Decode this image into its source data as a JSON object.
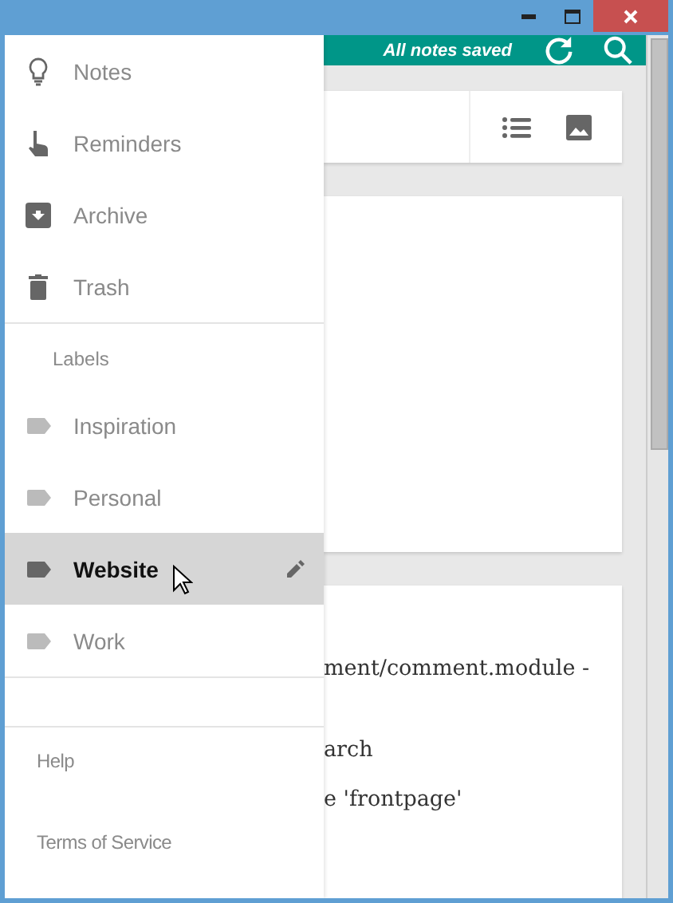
{
  "header": {
    "status": "All notes saved"
  },
  "drawer": {
    "nav": [
      {
        "label": "Notes",
        "kind": "bulb"
      },
      {
        "label": "Reminders",
        "kind": "hand"
      },
      {
        "label": "Archive",
        "kind": "archive"
      },
      {
        "label": "Trash",
        "kind": "trash"
      }
    ],
    "labels_heading": "Labels",
    "labels": [
      {
        "label": "Inspiration",
        "selected": false
      },
      {
        "label": "Personal",
        "selected": false
      },
      {
        "label": "Website",
        "selected": true
      },
      {
        "label": "Work",
        "selected": false
      }
    ],
    "footer": [
      "Help",
      "Terms of Service"
    ]
  },
  "note_lines": [
    "ment/comment.module -",
    "arch",
    "e 'frontpage'"
  ]
}
